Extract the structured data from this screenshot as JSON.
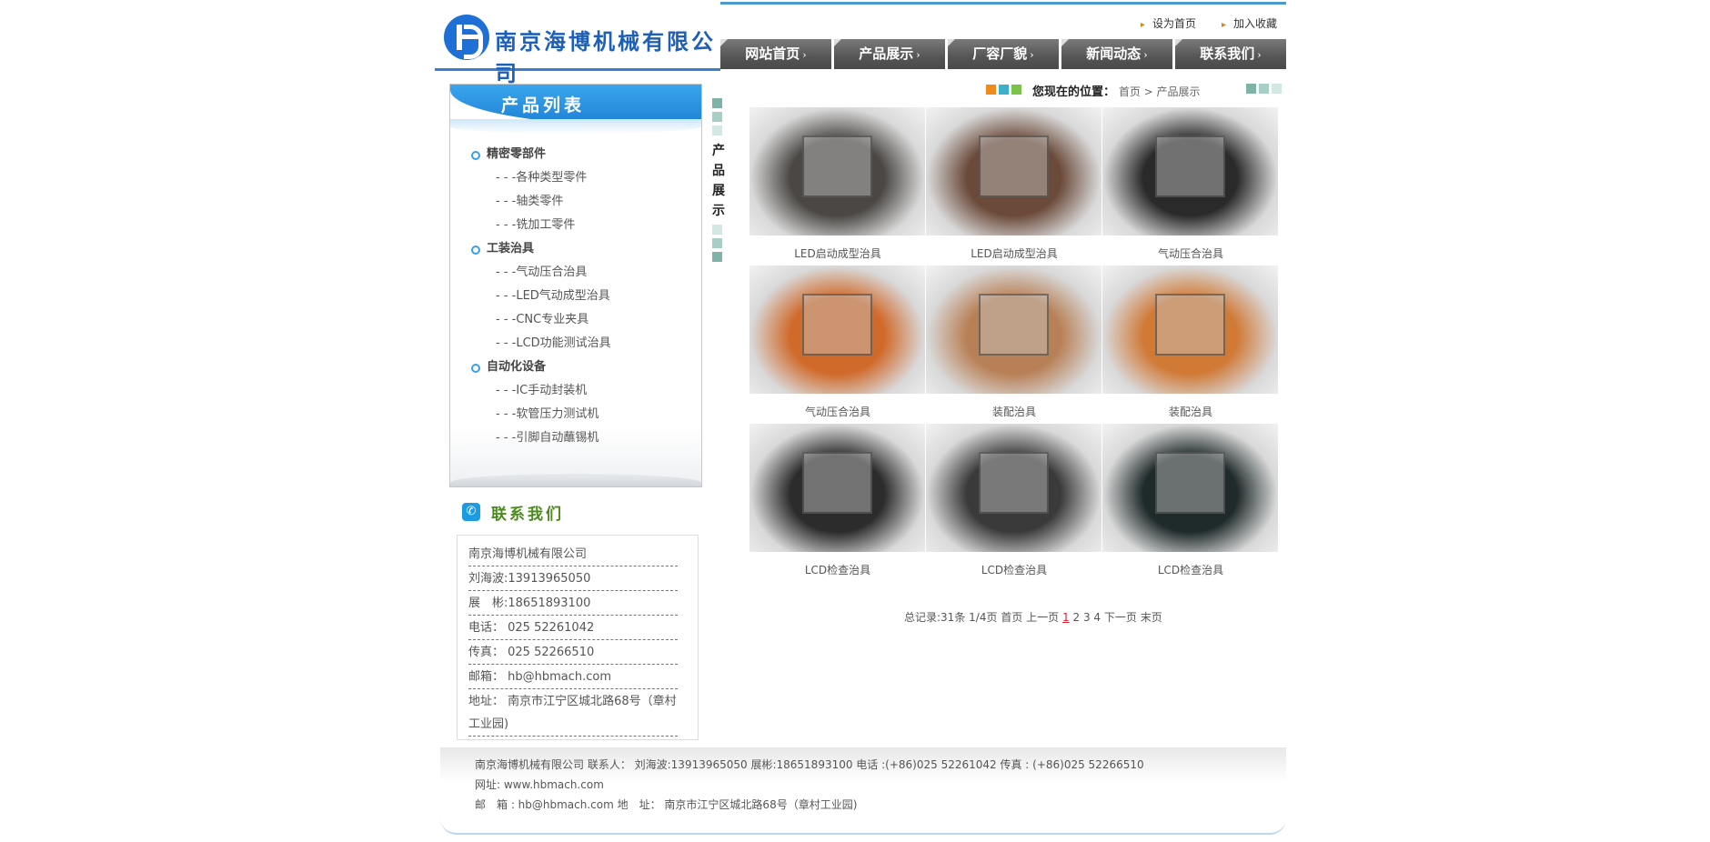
{
  "header": {
    "company_logo_text": "南京海博机械有限公司",
    "top_links": [
      "设为首页",
      "加入收藏"
    ],
    "nav": [
      "网站首页",
      "产品展示",
      "厂容厂貌",
      "新闻动态",
      "联系我们"
    ],
    "nav_arrow": "›"
  },
  "sidebar": {
    "title": "产品列表",
    "categories": [
      {
        "name": "精密零部件",
        "items": [
          "- - -各种类型零件",
          "- - -轴类零件",
          "- - -铣加工零件"
        ]
      },
      {
        "name": "工装治具",
        "items": [
          "- - -气动压合治具",
          "- - -LED气动成型治具",
          "- - -CNC专业夹具",
          "- - -LCD功能测试治具"
        ]
      },
      {
        "name": "自动化设备",
        "items": [
          "- - -IC手动封装机",
          "- - -软管压力测试机",
          "- - -引脚自动蘸锡机"
        ]
      }
    ],
    "contact_title": "联系我们",
    "contact_lines": [
      "南京海博机械有限公司",
      "刘海波:13913965050",
      "展　彬:18651893100",
      "电话： 025 52261042",
      "传真： 025 52266510",
      "邮箱： hb@hbmach.com",
      "地址： 南京市江宁区城北路68号（章村工业园)"
    ]
  },
  "main": {
    "vertical_tab": [
      "产",
      "品",
      "展",
      "示"
    ],
    "location_label": "您现在的位置：",
    "breadcrumb": "首页 > 产品展示",
    "products": [
      {
        "caption": "LED启动成型治具",
        "tone": "#4a4744"
      },
      {
        "caption": "LED启动成型治具",
        "tone": "#6b4a3a"
      },
      {
        "caption": "气动压合治具",
        "tone": "#2a2a2a"
      },
      {
        "caption": "气动压合治具",
        "tone": "#d06a2a"
      },
      {
        "caption": "装配治具",
        "tone": "#b88056"
      },
      {
        "caption": "装配治具",
        "tone": "#d07a36"
      },
      {
        "caption": "LCD检查治具",
        "tone": "#2c2c2c"
      },
      {
        "caption": "LCD检查治具",
        "tone": "#3a3a3a"
      },
      {
        "caption": "LCD检查治具",
        "tone": "#1f2a2a"
      }
    ],
    "pager": {
      "total": "总记录:31条",
      "pages": "1/4页",
      "first": "首页",
      "prev": "上一页",
      "current": "1",
      "others": [
        "2",
        "3",
        "4"
      ],
      "next": "下一页",
      "last": "末页"
    }
  },
  "footer": {
    "line1": "南京海博机械有限公司 联系人： 刘海波:13913965050 展彬:18651893100 电话 :(+86)025 52261042 传真 : (+86)025 52266510",
    "line2": "网址: www.hbmach.com",
    "line3": "邮　箱 : hb@hbmach.com 地　址： 南京市江宁区城北路68号（章村工业园)"
  },
  "colors": {
    "accent_blue": "#1e6fd6",
    "nav_gray": "#555555",
    "square_orange": "#f08a1c",
    "square_teal": "#3bb0c8",
    "square_green": "#7cc24a",
    "square_gray": "#7fb3a8"
  }
}
